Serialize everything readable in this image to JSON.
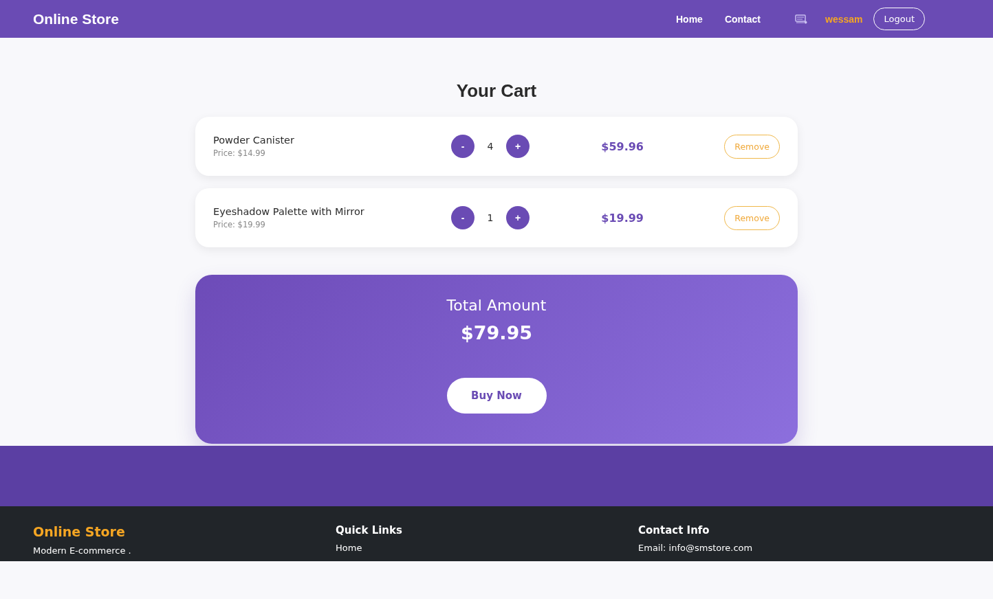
{
  "header": {
    "brand": "Online Store",
    "nav": [
      {
        "label": "Home"
      },
      {
        "label": "Contact"
      }
    ],
    "username": "wessam",
    "logout": "Logout"
  },
  "cart": {
    "title": "Your Cart",
    "items": [
      {
        "name": "Powder Canister",
        "price": "Price: $14.99",
        "decrement": "-",
        "quantity": "4",
        "increment": "+",
        "subtotal": "$59.96",
        "remove": "Remove"
      },
      {
        "name": "Eyeshadow Palette with Mirror",
        "price": "Price: $19.99",
        "decrement": "-",
        "quantity": "1",
        "increment": "+",
        "subtotal": "$19.99",
        "remove": "Remove"
      }
    ],
    "total": {
      "label": "Total Amount",
      "amount": "$79.95",
      "button": "Buy Now"
    }
  },
  "footer": {
    "brand": "Online Store",
    "tagline": "Modern E-commerce .",
    "quick_links": {
      "title": "Quick Links",
      "links": [
        "Home"
      ]
    },
    "contact": {
      "title": "Contact Info",
      "lines": [
        "Email: info@smstore.com"
      ]
    }
  }
}
